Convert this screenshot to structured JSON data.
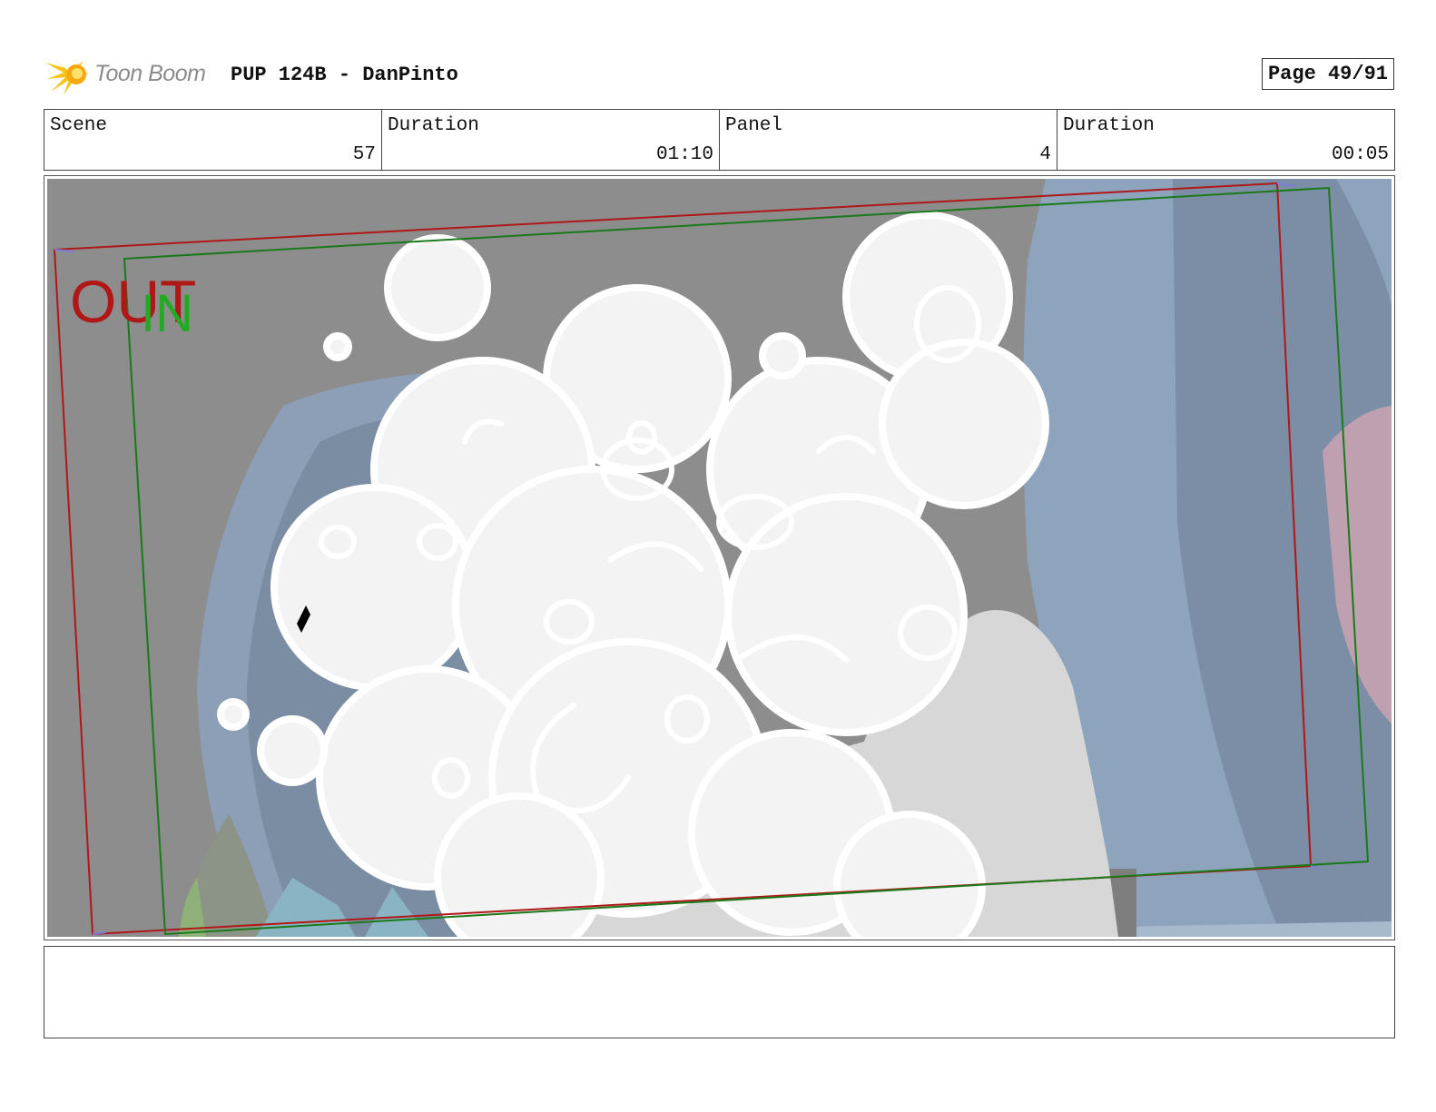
{
  "header": {
    "logo_text": "Toon Boom",
    "project_title": "PUP 124B - DanPinto",
    "page_label": "Page 49/91"
  },
  "info": {
    "scene_label": "Scene",
    "scene_value": "57",
    "scene_duration_label": "Duration",
    "scene_duration_value": "01:10",
    "panel_label": "Panel",
    "panel_value": "4",
    "panel_duration_label": "Duration",
    "panel_duration_value": "00:05"
  },
  "panel": {
    "out_label": "OUT",
    "in_label": "IN",
    "colors": {
      "out_frame": "#b01818",
      "in_frame": "#1a7a1a",
      "background": "#8d8d8d",
      "smoke": "#f3f3f3",
      "walls": "#8da2bb"
    }
  },
  "notes": {
    "text": ""
  }
}
